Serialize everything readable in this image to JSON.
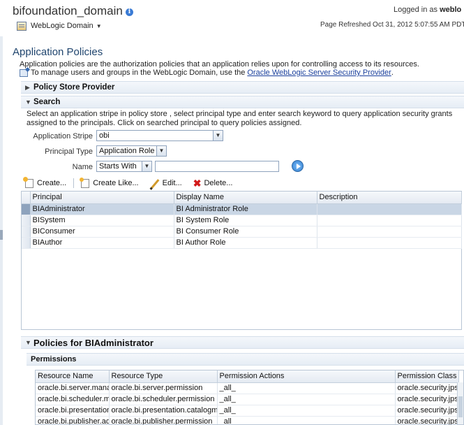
{
  "header": {
    "domain_title": "bifoundation_domain",
    "logged_in_label": "Logged in as",
    "logged_in_user": "weblo",
    "weblogic_menu": "WebLogic Domain",
    "page_refreshed": "Page Refreshed Oct 31, 2012 5:07:55 AM PDT"
  },
  "main": {
    "heading": "Application Policies",
    "description": "Application policies are the authorization policies that an application relies upon for controlling access to its resources.",
    "manage_text": "To manage users and groups in the WebLogic Domain, use the",
    "manage_link": "Oracle WebLogic Server Security Provider",
    "manage_end": "."
  },
  "policy_store": {
    "title": "Policy Store Provider"
  },
  "search": {
    "title": "Search",
    "description": "Select an application stripe in policy store , select principal type and enter search keyword to query application security grants assigned to the principals. Click on searched principal to query policies assigned.",
    "stripe_label": "Application Stripe",
    "stripe_value": "obi",
    "principal_type_label": "Principal Type",
    "principal_type_value": "Application Role",
    "name_label": "Name",
    "name_operator": "Starts With",
    "name_value": ""
  },
  "toolbar": {
    "create": "Create...",
    "create_like": "Create Like...",
    "edit": "Edit...",
    "delete": "Delete..."
  },
  "principals_table": {
    "columns": [
      "Principal",
      "Display Name",
      "Description"
    ],
    "rows": [
      {
        "principal": "BIAdministrator",
        "display_name": "BI Administrator Role",
        "description": ""
      },
      {
        "principal": "BISystem",
        "display_name": "BI System Role",
        "description": ""
      },
      {
        "principal": "BIConsumer",
        "display_name": "BI Consumer Role",
        "description": ""
      },
      {
        "principal": "BIAuthor",
        "display_name": "BI Author Role",
        "description": ""
      }
    ],
    "selected_index": 0
  },
  "policies": {
    "title": "Policies for BIAdministrator",
    "permissions_title": "Permissions",
    "columns": [
      "Resource Name",
      "Resource Type",
      "Permission Actions",
      "Permission Class"
    ],
    "rows": [
      {
        "resource_name": "oracle.bi.server.mana",
        "resource_type": "oracle.bi.server.permission",
        "actions": "_all_",
        "class": "oracle.security.jps."
      },
      {
        "resource_name": "oracle.bi.scheduler.m",
        "resource_type": "oracle.bi.scheduler.permission",
        "actions": "_all_",
        "class": "oracle.security.jps."
      },
      {
        "resource_name": "oracle.bi.presentation",
        "resource_type": "oracle.bi.presentation.catalogm",
        "actions": "_all_",
        "class": "oracle.security.jps."
      },
      {
        "resource_name": "oracle.bi.publisher.ad",
        "resource_type": "oracle.bi.publisher.permission",
        "actions": "_all_",
        "class": "oracle.security.jps."
      }
    ]
  }
}
